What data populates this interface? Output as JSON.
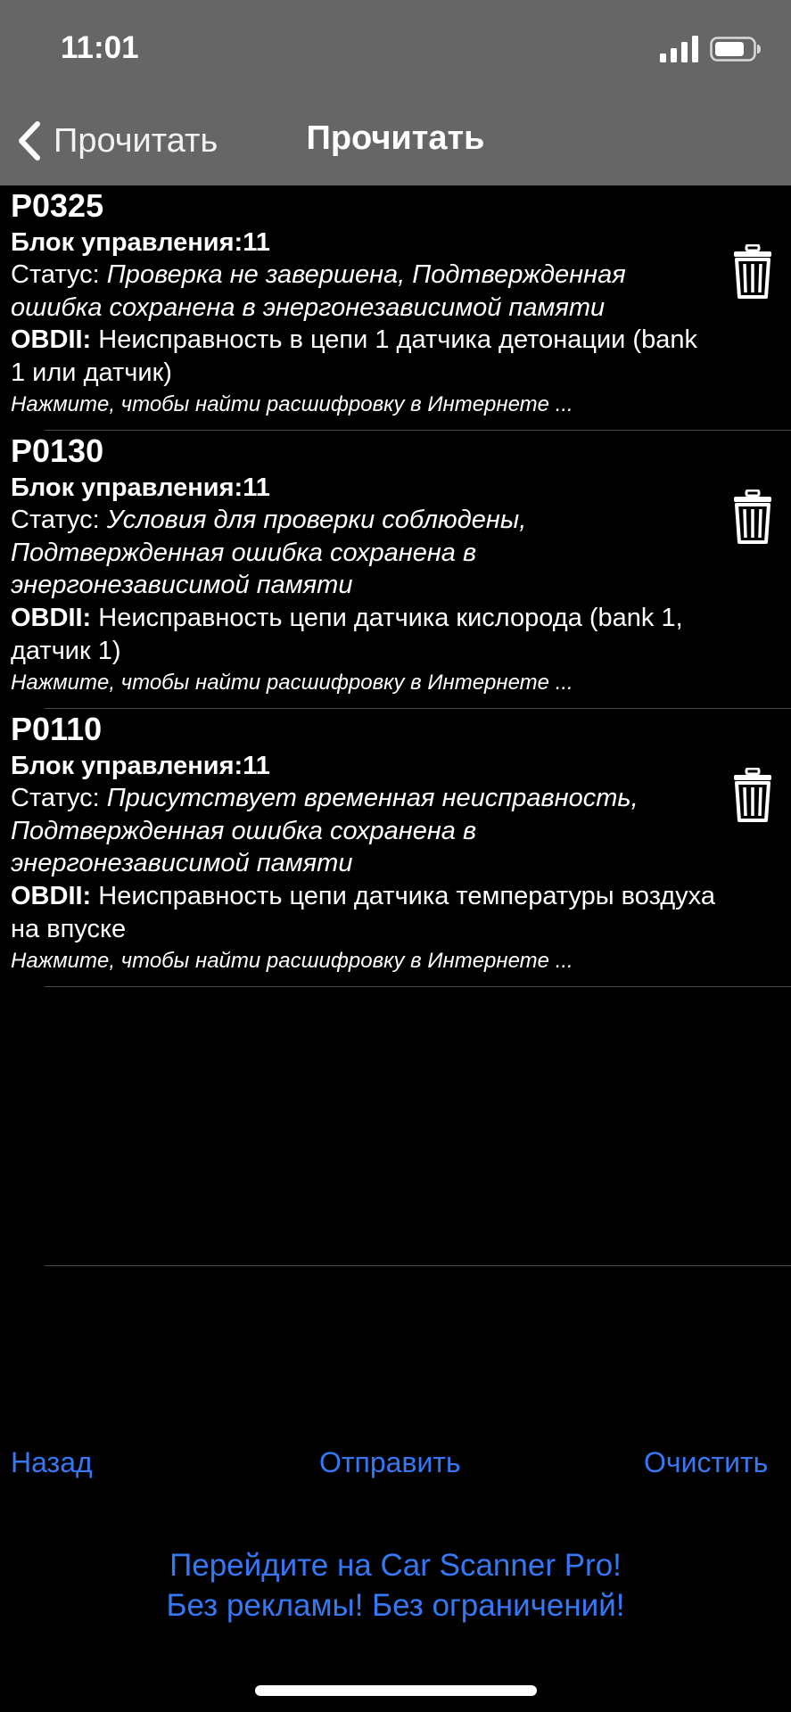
{
  "status_bar": {
    "time": "11:01"
  },
  "nav": {
    "back_label": "Прочитать",
    "title": "Прочитать"
  },
  "errors": [
    {
      "code": "P0325",
      "unit": "Блок управления:11",
      "status_label": "Статус:",
      "status_value": "Проверка не завершена, Подтвержденная ошибка сохранена в энергонезависимой памяти",
      "obd_label": "OBDII:",
      "obd_value": "Неисправность в цепи 1 датчика детонации (bank 1 или датчик)",
      "hint": "Нажмите, чтобы найти расшифровку в Интернете ..."
    },
    {
      "code": "P0130",
      "unit": "Блок управления:11",
      "status_label": "Статус:",
      "status_value": "Условия для проверки соблюдены, Подтвержденная ошибка сохранена в энергонезависимой памяти",
      "obd_label": "OBDII:",
      "obd_value": "Неисправность цепи датчика кислорода (bank 1, датчик 1)",
      "hint": "Нажмите, чтобы найти расшифровку в Интернете ..."
    },
    {
      "code": "P0110",
      "unit": "Блок управления:11",
      "status_label": "Статус:",
      "status_value": "Присутствует временная неисправность, Подтвержденная ошибка сохранена в энергонезависимой памяти",
      "obd_label": "OBDII:",
      "obd_value": "Неисправность цепи датчика температуры воздуха на впуске",
      "hint": "Нажмите, чтобы найти расшифровку в Интернете ..."
    }
  ],
  "toolbar": {
    "back": "Назад",
    "send": "Отправить",
    "clear": "Очистить"
  },
  "promo": {
    "line1": "Перейдите на Car Scanner Pro!",
    "line2": "Без рекламы! Без ограничений!"
  },
  "colors": {
    "accent": "#3478f6",
    "header_bg": "#666666",
    "background": "#000000"
  }
}
